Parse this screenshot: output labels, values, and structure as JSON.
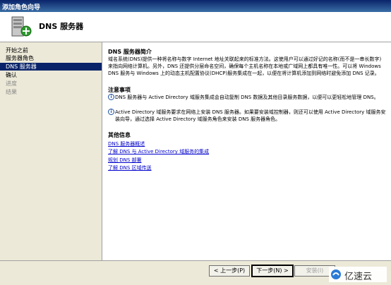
{
  "window": {
    "title": "添加角色向导"
  },
  "header": {
    "title": "DNS 服务器"
  },
  "sidebar": {
    "items": [
      {
        "label": "开始之前",
        "state": "normal"
      },
      {
        "label": "服务器角色",
        "state": "normal"
      },
      {
        "label": "DNS 服务器",
        "state": "selected"
      },
      {
        "label": "确认",
        "state": "normal"
      },
      {
        "label": "进度",
        "state": "disabled"
      },
      {
        "label": "结果",
        "state": "disabled"
      }
    ]
  },
  "main": {
    "intro_heading": "DNS 服务器简介",
    "intro_text": "域名系统(DNS)提供一种将名称与数字 Internet 地址关联起来的标准方法。这使用户可以通过好记的名称(而不是一串长数字)来指向网络计算机。另外，DNS 还提供分层命名空间，确保每个主机名称在本地或广域网上都具有唯一性。可以将 Windows DNS 服务与 Windows 上的动态主机配置协议(DHCP)服务集成在一起，以便在将计算机添加到网络时避免添加 DNS 记录。",
    "notes_heading": "注意事项",
    "notes": [
      "DNS 服务器与 Active Directory 域服务集成会自动复制 DNS 数据及其他目录服务数据，以便可以更轻松地管理 DNS。",
      "Active Directory 域服务要求在网络上安装 DNS 服务器。如果要安装域控制器，则还可以使用 Active Directory 域服务安装向导，通过选择 Active Directory 域服务角色来安装 DNS 服务器角色。"
    ],
    "more_heading": "其他信息",
    "links": [
      "DNS 服务器概述",
      "了解 DNS 与 Active Directory 域服务的集成",
      "规划 DNS 部署",
      "了解 DNS 区域传送"
    ]
  },
  "footer": {
    "back_label": "< 上一步(P)",
    "next_label": "下一步(N) >",
    "install_label": "安装(I)"
  },
  "watermark": {
    "text": "亿速云"
  }
}
